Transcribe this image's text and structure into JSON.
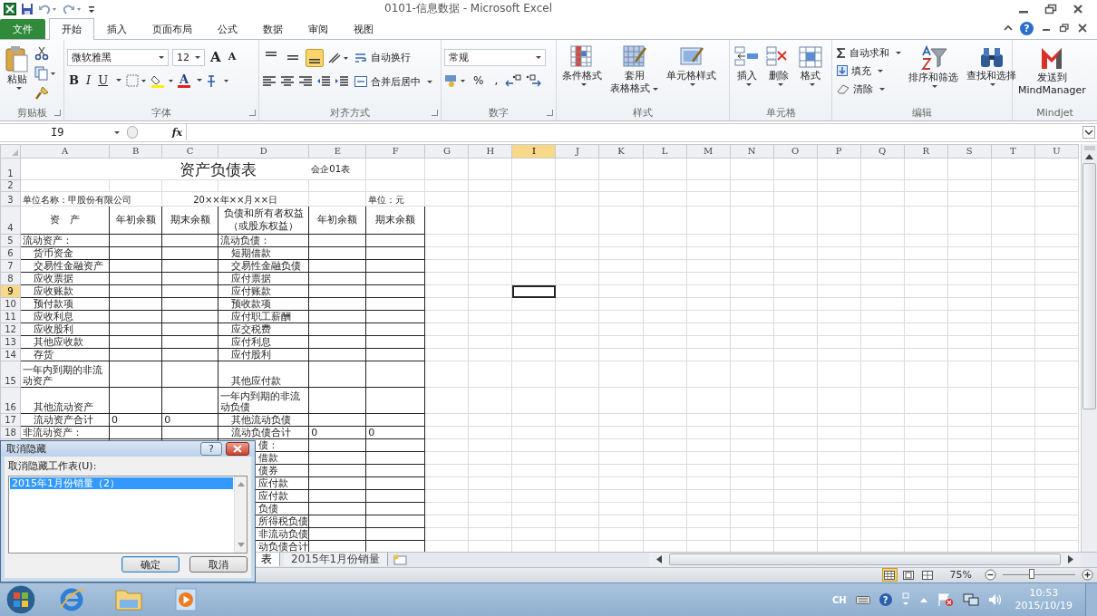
{
  "title_bar": {
    "title": "0101-信息数据 - Microsoft Excel"
  },
  "menu_tabs": [
    {
      "label": "文件",
      "kind": "file",
      "selected": false
    },
    {
      "label": "开始",
      "kind": "tab",
      "selected": true
    },
    {
      "label": "插入",
      "kind": "tab",
      "selected": false
    },
    {
      "label": "页面布局",
      "kind": "tab",
      "selected": false
    },
    {
      "label": "公式",
      "kind": "tab",
      "selected": false
    },
    {
      "label": "数据",
      "kind": "tab",
      "selected": false
    },
    {
      "label": "审阅",
      "kind": "tab",
      "selected": false
    },
    {
      "label": "视图",
      "kind": "tab",
      "selected": false
    }
  ],
  "help": "?",
  "ribbon": {
    "clipboard": {
      "label": "剪贴板",
      "paste": "粘贴"
    },
    "font": {
      "label": "字体",
      "font_name": "微软雅黑",
      "font_size": "12",
      "grow": "A",
      "shrink": "A",
      "bold": "B",
      "italic": "I",
      "underline": "U",
      "font_color": "A"
    },
    "alignment": {
      "label": "对齐方式",
      "wrap": "自动换行",
      "merge": "合并后居中",
      "vertical_align": [
        {
          "selected": false
        },
        {
          "selected": false
        },
        {
          "selected": true
        }
      ]
    },
    "number": {
      "label": "数字",
      "format": "常规",
      "percent": "%",
      "comma": ","
    },
    "styles": {
      "label": "样式",
      "conditional": "条件格式",
      "table_1": "套用",
      "table_2": "表格格式",
      "cell_styles": "单元格样式"
    },
    "cells": {
      "label": "单元格",
      "insert": "插入",
      "delete": "删除",
      "format": "格式"
    },
    "editing": {
      "label": "编辑",
      "autosum": "自动求和",
      "fill": "填充",
      "clear": "清除",
      "sort": "排序和筛选",
      "find": "查找和选择"
    },
    "mindjet": {
      "label": "Mindjet",
      "send_1": "发送到",
      "send_2": "MindManager"
    }
  },
  "formula_bar": {
    "name_box": "I9",
    "fx": "fx"
  },
  "grid": {
    "columns": [
      {
        "label": "A",
        "selected": false
      },
      {
        "label": "B",
        "selected": false
      },
      {
        "label": "C",
        "selected": false
      },
      {
        "label": "D",
        "selected": false
      },
      {
        "label": "E",
        "selected": false
      },
      {
        "label": "F",
        "selected": false
      },
      {
        "label": "G",
        "selected": false
      },
      {
        "label": "H",
        "selected": false
      },
      {
        "label": "I",
        "selected": true
      },
      {
        "label": "J",
        "selected": false
      },
      {
        "label": "K",
        "selected": false
      },
      {
        "label": "L",
        "selected": false
      },
      {
        "label": "M",
        "selected": false
      },
      {
        "label": "N",
        "selected": false
      },
      {
        "label": "O",
        "selected": false
      },
      {
        "label": "P",
        "selected": false
      },
      {
        "label": "Q",
        "selected": false
      },
      {
        "label": "R",
        "selected": false
      },
      {
        "label": "S",
        "selected": false
      },
      {
        "label": "T",
        "selected": false
      },
      {
        "label": "U",
        "selected": false
      }
    ],
    "rows": [
      {
        "number": "1",
        "kind": "title",
        "selected": false,
        "title": "资产负债表",
        "note": "会企01表"
      },
      {
        "number": "2",
        "kind": "plain",
        "selected": false
      },
      {
        "number": "3",
        "kind": "info",
        "selected": false,
        "company": "单位名称：甲股份有限公司",
        "date": "20××年××月××日",
        "unit": "单位：元"
      },
      {
        "number": "4",
        "kind": "header",
        "selected": false,
        "asset": "资　产",
        "asset_opening": "年初余额",
        "asset_closing": "期末余额",
        "liability": "负债和所有者权益（或股东权益）",
        "liability_opening": "年初余额",
        "liability_closing": "期末余额"
      },
      {
        "number": "5",
        "kind": "body",
        "selected": false,
        "asset": "流动资产：",
        "asset_indented": false,
        "liability": "流动负债：",
        "liability_indented": false
      },
      {
        "number": "6",
        "kind": "body",
        "selected": false,
        "asset": "货币资金",
        "asset_indented": true,
        "liability": "短期借款",
        "liability_indented": true
      },
      {
        "number": "7",
        "kind": "body",
        "selected": false,
        "asset": "交易性金融资产",
        "asset_indented": true,
        "liability": "交易性金融负债",
        "liability_indented": true
      },
      {
        "number": "8",
        "kind": "body",
        "selected": false,
        "asset": "应收票据",
        "asset_indented": true,
        "liability": "应付票据",
        "liability_indented": true
      },
      {
        "number": "9",
        "kind": "body",
        "selected": true,
        "asset": "应收账款",
        "asset_indented": true,
        "liability": "应付账款",
        "liability_indented": true
      },
      {
        "number": "10",
        "kind": "body",
        "selected": false,
        "asset": "预付款项",
        "asset_indented": true,
        "liability": "预收款项",
        "liability_indented": true
      },
      {
        "number": "11",
        "kind": "body",
        "selected": false,
        "asset": "应收利息",
        "asset_indented": true,
        "liability": "应付职工薪酬",
        "liability_indented": true
      },
      {
        "number": "12",
        "kind": "body",
        "selected": false,
        "asset": "应收股利",
        "asset_indented": true,
        "liability": "应交税费",
        "liability_indented": true
      },
      {
        "number": "13",
        "kind": "body",
        "selected": false,
        "asset": "其他应收款",
        "asset_indented": true,
        "liability": "应付利息",
        "liability_indented": true
      },
      {
        "number": "14",
        "kind": "body",
        "selected": false,
        "asset": "存货",
        "asset_indented": true,
        "liability": "应付股利",
        "liability_indented": true
      },
      {
        "number": "15",
        "kind": "tall",
        "selected": false,
        "asset": "一年内到期的非流动资产",
        "asset_indented": false,
        "liability": "其他应付款",
        "liability_indented": true
      },
      {
        "number": "16",
        "kind": "tall",
        "selected": false,
        "asset": "其他流动资产",
        "asset_indented": true,
        "liability": "一年内到期的非流动负债",
        "liability_indented": false
      },
      {
        "number": "17",
        "kind": "body",
        "selected": false,
        "asset": "流动资产合计",
        "asset_indented": true,
        "asset_opening": "0",
        "asset_closing": "0",
        "liability": "其他流动负债",
        "liability_indented": true
      },
      {
        "number": "18",
        "kind": "body",
        "selected": false,
        "asset": "非流动资产：",
        "asset_indented": false,
        "liability": "流动负债合计",
        "liability_indented": true,
        "liability_opening": "0",
        "liability_closing": "0"
      },
      {
        "kind": "covered",
        "selected": false,
        "liability": "债："
      },
      {
        "kind": "covered",
        "selected": false,
        "liability": "借款"
      },
      {
        "kind": "covered",
        "selected": false,
        "liability": "债券"
      },
      {
        "kind": "covered",
        "selected": false,
        "liability": "应付款"
      },
      {
        "kind": "covered",
        "selected": false,
        "liability": "应付款"
      },
      {
        "kind": "covered",
        "selected": false,
        "liability": "负债"
      },
      {
        "kind": "covered",
        "selected": false,
        "liability": "所得税负债"
      },
      {
        "kind": "covered",
        "selected": false,
        "liability": "非流动负债"
      },
      {
        "kind": "covered",
        "selected": false,
        "liability": "动负债合计"
      }
    ]
  },
  "sheet_tabs": [
    {
      "label": "表",
      "selected": true
    },
    {
      "label": "2015年1月份销量",
      "selected": false
    }
  ],
  "status_bar": {
    "views": [
      {
        "selected": true
      },
      {
        "selected": false
      },
      {
        "selected": false
      }
    ],
    "zoom": "75%",
    "zoom_slider": {
      "level": 0.4
    }
  },
  "dialog": {
    "title": "取消隐藏",
    "help": "?",
    "list_label": "取消隐藏工作表(U):",
    "items": [
      {
        "label": "2015年1月份销量（2）",
        "selected": true
      }
    ],
    "buttons": [
      {
        "label": "确定",
        "default": true
      },
      {
        "label": "取消",
        "default": false
      }
    ]
  },
  "taskbar": {
    "language": "CH",
    "help": "?",
    "time": "10:53",
    "date": "2015/10/19"
  }
}
